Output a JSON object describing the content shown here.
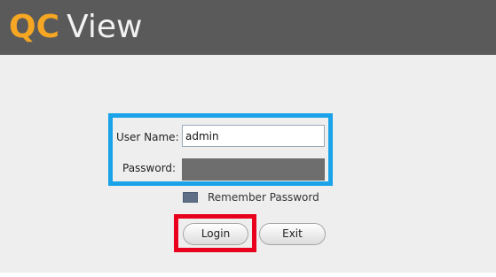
{
  "app": {
    "logo_brand": "QC",
    "logo_product": "View"
  },
  "login_form": {
    "username_label": "User Name:",
    "username_value": "admin",
    "password_label": "Password:",
    "remember_label": "Remember Password",
    "login_label": "Login",
    "exit_label": "Exit"
  },
  "colors": {
    "titlebar": "#5a5a5a",
    "brand_accent": "#f5a623",
    "highlight_form": "#1aa3e8",
    "highlight_login": "#e8001c"
  }
}
